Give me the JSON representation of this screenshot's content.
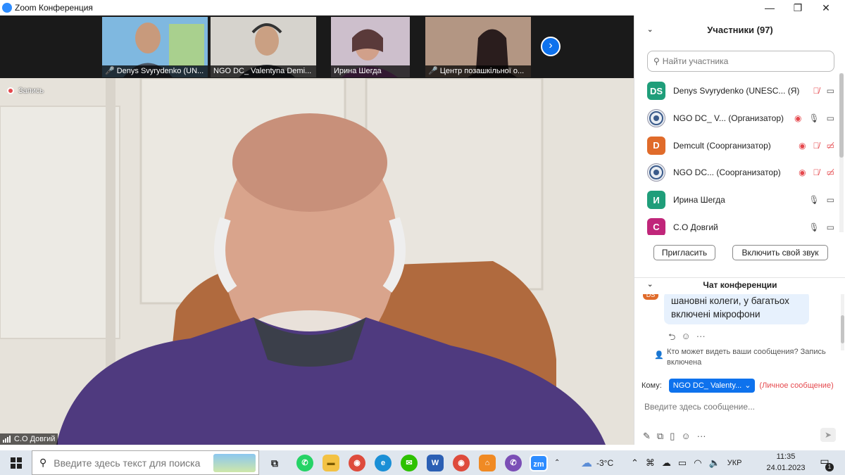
{
  "window": {
    "title": "Zoom Конференция",
    "controls": [
      "—",
      "❐",
      "✕"
    ]
  },
  "thumbnails": [
    {
      "name": "Denys Svyrydenko (UN...",
      "muted": true
    },
    {
      "name": "NGO DC_ Valentyna Demi...",
      "muted": false
    },
    {
      "name": "Ирина Шегда",
      "muted": false
    },
    {
      "name": "Центр позашкільної о...",
      "muted": true
    }
  ],
  "main_video": {
    "recording_label": "Запись",
    "speaker_name": "С.О Довгий"
  },
  "participants_panel": {
    "title": "Участники (97)",
    "search_placeholder": "Найти участника",
    "list": [
      {
        "initials": "DS",
        "name": "Denys Svyrydenko (UNESC...",
        "tag": "(Я)",
        "color": "#1f9e7a"
      },
      {
        "initials": "",
        "name": "NGO DC_ V...",
        "tag": "(Организатор)",
        "color": "#e8edf3"
      },
      {
        "initials": "D",
        "name": "Demcult",
        "tag": "(Соорганизатор)",
        "color": "#e06b2a"
      },
      {
        "initials": "",
        "name": "NGO DC...",
        "tag": "(Соорганизатор)",
        "color": "#e8edf3"
      },
      {
        "initials": "И",
        "name": "Ирина Шегда",
        "tag": "",
        "color": "#1f9e7a"
      },
      {
        "initials": "С",
        "name": "С.О Довгий",
        "tag": "",
        "color": "#c0267a"
      }
    ],
    "invite_label": "Пригласить",
    "unmute_label": "Включить свой звук"
  },
  "chat": {
    "title": "Чат конференции",
    "sender_initials": "DS",
    "message": "шановні колеги, у багатьох включені мікрофони",
    "notice": "Кто может видеть ваши сообщения? Запись включена",
    "to_label": "Кому:",
    "recipient": "NGO DC_ Valenty...",
    "private_label": "(Личное сообщение)",
    "input_placeholder": "Введите здесь сообщение..."
  },
  "taskbar": {
    "search_placeholder": "Введите здесь текст для поиска",
    "weather": "-3°C",
    "language": "УКР",
    "time": "11:35",
    "date": "24.01.2023",
    "notifications": "1"
  },
  "colors": {
    "accent": "#0e72ed",
    "mute_red": "#e5484d"
  }
}
